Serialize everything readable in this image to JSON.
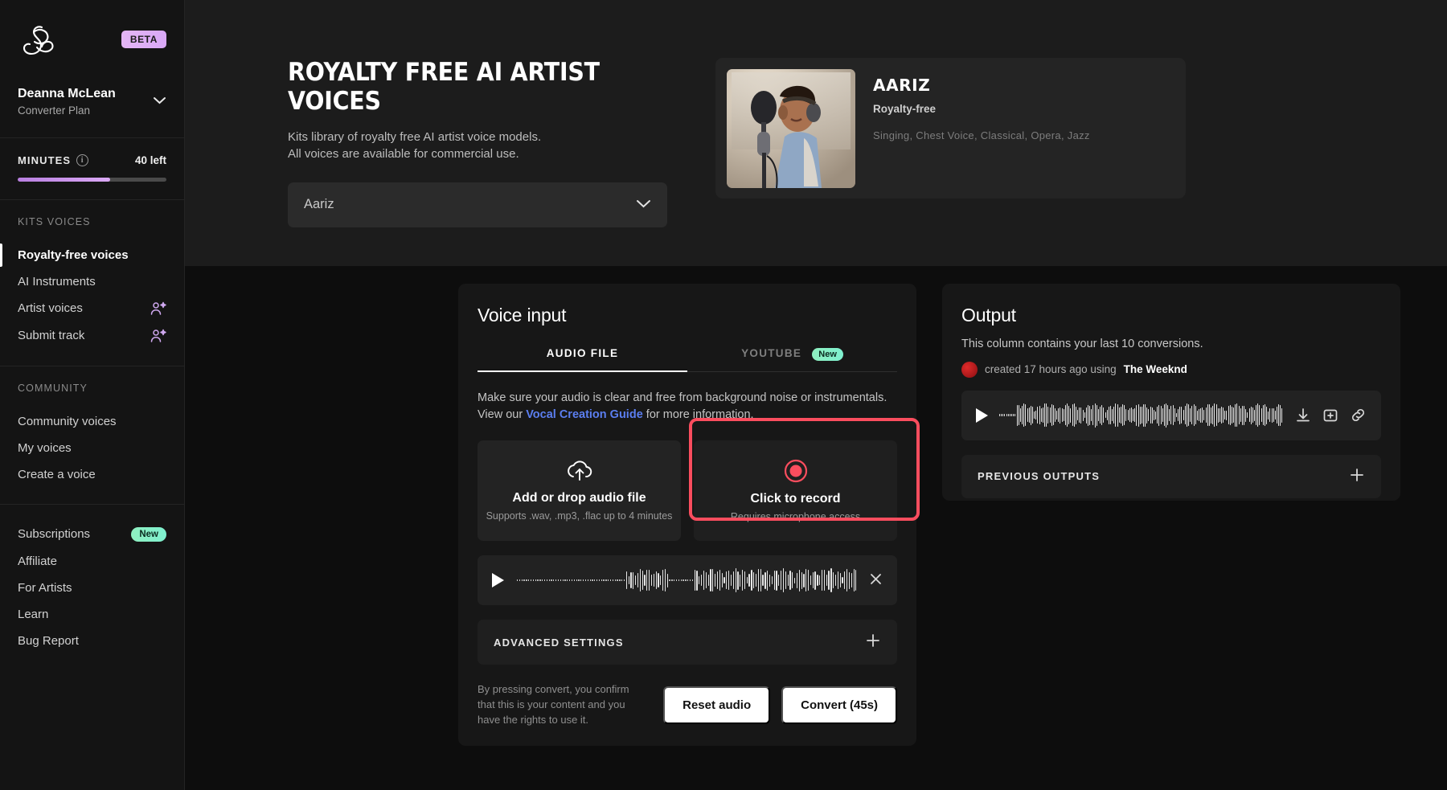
{
  "sidebar": {
    "logo_icon": "kits-ampersand-logo",
    "beta_badge": "BETA",
    "account": {
      "name": "Deanna McLean",
      "plan": "Converter Plan",
      "chevron": "chevron-down-icon"
    },
    "minutes": {
      "label": "MINUTES",
      "info_icon": "info-icon",
      "left": "40 left",
      "progress_percent": 62
    },
    "groups": [
      {
        "heading": "KITS VOICES",
        "items": [
          {
            "label": "Royalty-free voices",
            "active": true,
            "icon": null,
            "badge": null
          },
          {
            "label": "AI Instruments",
            "active": false,
            "icon": null,
            "badge": null
          },
          {
            "label": "Artist voices",
            "active": false,
            "icon": "user-sparkle-icon",
            "badge": null
          },
          {
            "label": "Submit track",
            "active": false,
            "icon": "user-sparkle-icon",
            "badge": null
          }
        ]
      },
      {
        "heading": "COMMUNITY",
        "items": [
          {
            "label": "Community voices",
            "active": false,
            "icon": null,
            "badge": null
          },
          {
            "label": "My voices",
            "active": false,
            "icon": null,
            "badge": null
          },
          {
            "label": "Create a voice",
            "active": false,
            "icon": null,
            "badge": null
          }
        ]
      },
      {
        "heading": null,
        "items": [
          {
            "label": "Subscriptions",
            "active": false,
            "icon": null,
            "badge": "New"
          },
          {
            "label": "Affiliate",
            "active": false,
            "icon": null,
            "badge": null
          },
          {
            "label": "For Artists",
            "active": false,
            "icon": null,
            "badge": null
          },
          {
            "label": "Learn",
            "active": false,
            "icon": null,
            "badge": null
          },
          {
            "label": "Bug Report",
            "active": false,
            "icon": null,
            "badge": null
          }
        ]
      }
    ]
  },
  "hero": {
    "title": "ROYALTY FREE AI ARTIST VOICES",
    "sub_line1": "Kits library of royalty free AI artist voice models.",
    "sub_line2": "All voices are available for commercial use.",
    "select": {
      "value": "Aariz",
      "chevron": "chevron-down-icon"
    },
    "card": {
      "name": "AARIZ",
      "type": "Royalty-free",
      "tags": "Singing, Chest Voice, Classical, Opera, Jazz",
      "thumb_alt": "singer-at-microphone-photo"
    }
  },
  "voice_input": {
    "heading": "Voice input",
    "tabs": [
      {
        "label": "AUDIO FILE",
        "active": true,
        "badge": null
      },
      {
        "label": "YOUTUBE",
        "active": false,
        "badge": "New"
      }
    ],
    "helper_pre": "Make sure your audio is clear and free from background noise or instrumentals. View our ",
    "helper_link": "Vocal Creation Guide",
    "helper_post": " for more information.",
    "upload_card": {
      "icon": "cloud-upload-icon",
      "title": "Add or drop audio file",
      "sub": "Supports .wav, .mp3, .flac up to 4 minutes"
    },
    "record_card": {
      "icon": "record-circle-icon",
      "title": "Click to record",
      "sub": "Requires microphone access",
      "highlight_color": "#fa4d5e"
    },
    "player": {
      "play_icon": "play-icon",
      "close_icon": "close-icon"
    },
    "advanced": {
      "label": "ADVANCED SETTINGS",
      "toggle_icon": "plus-icon"
    },
    "disclaimer": "By pressing convert, you confirm that this is your content and you have the rights to use it.",
    "reset_label": "Reset audio",
    "convert_label": "Convert (45s)"
  },
  "output": {
    "heading": "Output",
    "sub": "This column contains your last 10 conversions.",
    "entry": {
      "avatar": "artist-avatar",
      "text_pre": "created 17 hours ago using ",
      "artist": "The Weeknd"
    },
    "player": {
      "play_icon": "play-icon",
      "download_icon": "download-icon",
      "save_icon": "save-to-library-icon",
      "link_icon": "copy-link-icon"
    },
    "previous": {
      "label": "PREVIOUS OUTPUTS",
      "toggle_icon": "plus-icon"
    }
  },
  "colors": {
    "accent_purple": "#dba9f5",
    "accent_green": "#8ff0c0",
    "accent_red": "#fa4d5e",
    "link_blue": "#5b7ef0"
  }
}
